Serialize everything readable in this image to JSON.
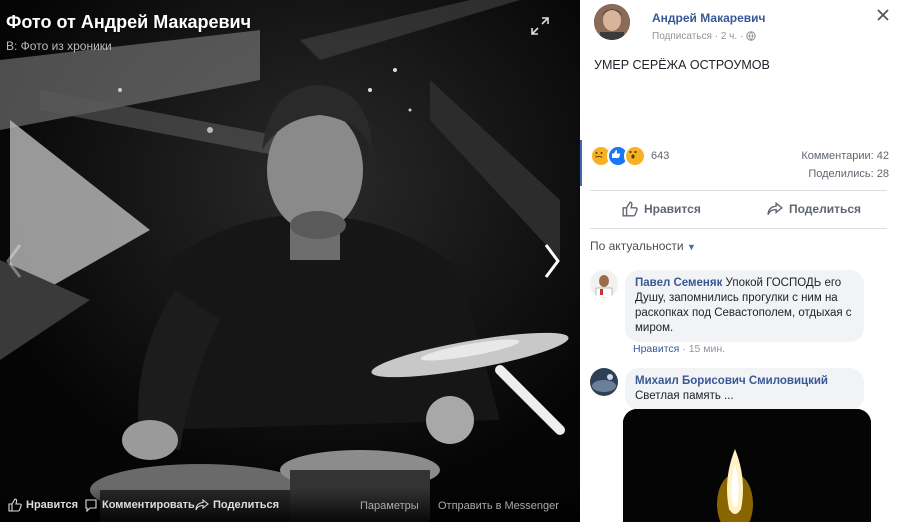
{
  "photo_viewer": {
    "title": "Фото от Андрей Макаревич",
    "subtitle": "В: Фото из хроники",
    "expand_icon": "expand-icon",
    "prev_icon": "chevron-left-icon",
    "next_icon": "chevron-right-icon",
    "bottom_bar": {
      "like": "Нравится",
      "comment": "Комментировать",
      "share": "Поделиться",
      "options": "Параметры",
      "send": "Отправить в Messenger"
    }
  },
  "post": {
    "author": "Андрей Макаревич",
    "meta_follow": "Подписаться",
    "meta_sep": "·",
    "meta_time": "2 ч.",
    "meta_audience_icon": "globe-icon",
    "text": "УМЕР СЕРЁЖА ОСТРОУМОВ",
    "reactions": {
      "icons": [
        "sad-icon",
        "like-icon",
        "wow-icon"
      ],
      "count": "643"
    },
    "comments_label": "Комментарии: 42",
    "shares_label": "Поделились: 28",
    "actions": {
      "like": "Нравится",
      "share": "Поделиться"
    },
    "sort_label": "По актуальности",
    "comments": [
      {
        "name": "Павел Семеняк",
        "text": "Упокой ГОСПОДЬ его Душу, запомнились прогулки с ним на раскопках под Севастополем, отдыхая с миром.",
        "like": "Нравится",
        "sep": "·",
        "time": "15 мин."
      },
      {
        "name": "Михаил Борисович Смиловицкий",
        "text": "Светлая память ..."
      }
    ]
  },
  "colors": {
    "link": "#385898",
    "accent": "#4267b2",
    "muted": "#90949c",
    "bubble": "#f2f3f5"
  }
}
